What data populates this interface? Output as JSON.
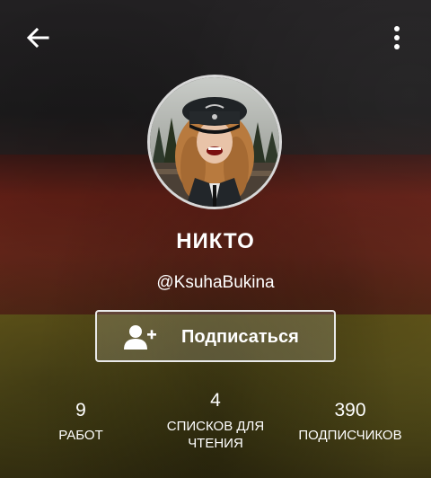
{
  "colors": {
    "text": "#ffffff",
    "button_border": "#e9e9e9",
    "avatar_border": "#d8d8d8"
  },
  "topbar": {
    "back_icon": "arrow-left-icon",
    "menu_icon": "more-vertical-icon"
  },
  "profile": {
    "name": "НИКТО",
    "handle": "@KsuhaBukina"
  },
  "subscribe": {
    "icon": "add-user-icon",
    "label": "Подписаться"
  },
  "stats": [
    {
      "value": "9",
      "label": "РАБОТ"
    },
    {
      "value": "4",
      "label_line1": "СПИСКОВ ДЛЯ",
      "label_line2": "ЧТЕНИЯ"
    },
    {
      "value": "390",
      "label": "ПОДПИСЧИКОВ"
    }
  ]
}
